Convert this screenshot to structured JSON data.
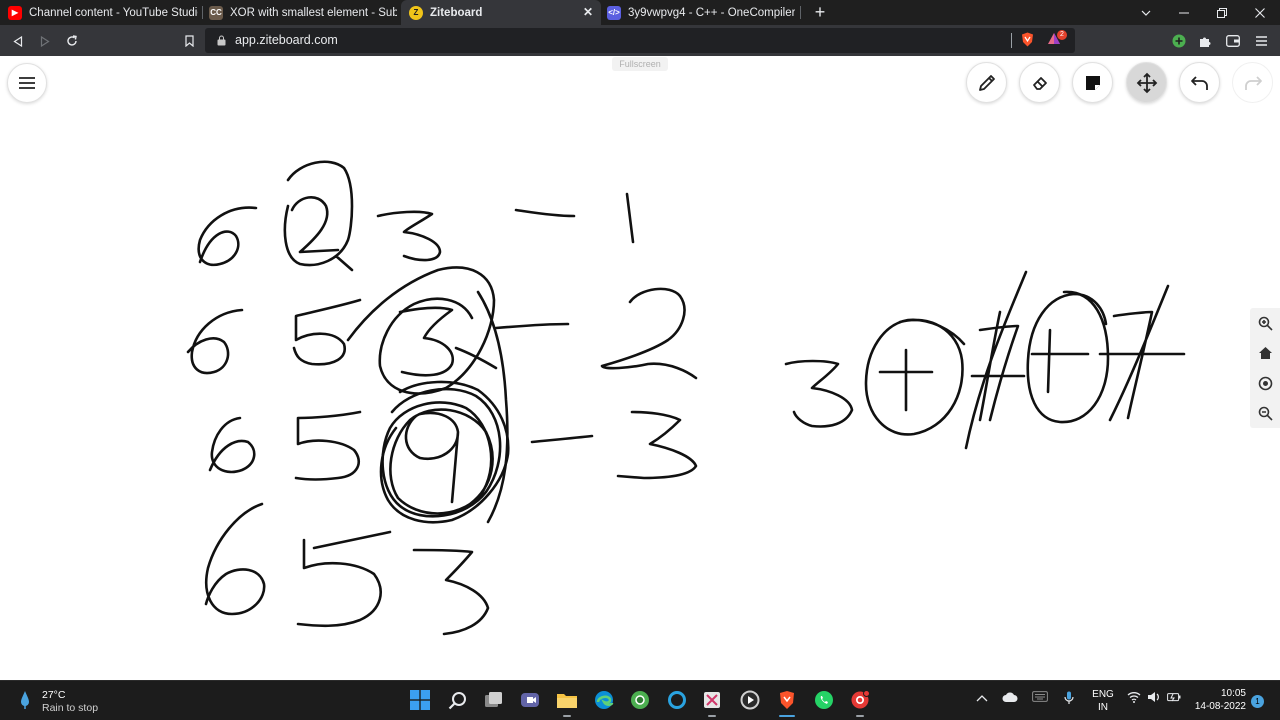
{
  "browser": {
    "tabs": [
      {
        "label": "Channel content - YouTube Studio",
        "icon": "youtube-icon",
        "color": "#ff0000"
      },
      {
        "label": "XOR with smallest element - Submit |",
        "icon": "codechef-icon",
        "color": "#6b5b4b"
      },
      {
        "label": "Ziteboard",
        "icon": "ziteboard-icon",
        "color": "#f0c419",
        "active": true
      },
      {
        "label": "3y9vwpvg4 - C++ - OneCompiler",
        "icon": "onecompiler-icon",
        "color": "#5b5fe0"
      }
    ],
    "new_tab": "+",
    "url": "app.ziteboard.com",
    "rewards_badge": "2"
  },
  "app": {
    "fullscreen_hint": "Fullscreen",
    "tools": [
      "pen-tool",
      "eraser-tool",
      "sticky-note-tool",
      "move-tool",
      "undo",
      "redo"
    ],
    "active_tool": "move-tool",
    "side_controls": [
      "zoom-in",
      "home",
      "locate",
      "zoom-out"
    ]
  },
  "taskbar": {
    "weather_temp": "27°C",
    "weather_desc": "Rain to stop",
    "lang_line1": "ENG",
    "lang_line2": "IN",
    "time": "10:05",
    "date": "14-08-2022",
    "notification_count": "1"
  },
  "colors": {
    "ink": "#111111",
    "tab_bar": "#1f1f1f",
    "toolbar": "#35363a",
    "taskbar": "#1c1c1c"
  }
}
